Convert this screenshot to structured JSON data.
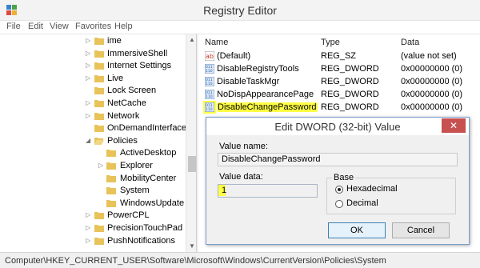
{
  "window": {
    "title": "Registry Editor",
    "icon": "registry-editor-icon"
  },
  "menu": [
    "File",
    "Edit",
    "View",
    "Favorites",
    "Help"
  ],
  "tree": {
    "items": [
      {
        "label": "ime",
        "expandable": true
      },
      {
        "label": "ImmersiveShell",
        "expandable": true
      },
      {
        "label": "Internet Settings",
        "expandable": true
      },
      {
        "label": "Live",
        "expandable": true
      },
      {
        "label": "Lock Screen",
        "expandable": false
      },
      {
        "label": "NetCache",
        "expandable": true
      },
      {
        "label": "Network",
        "expandable": true
      },
      {
        "label": "OnDemandInterfaceCa",
        "expandable": false
      },
      {
        "label": "Policies",
        "expandable": true,
        "expanded": true
      },
      {
        "label": "ActiveDesktop",
        "expandable": false
      },
      {
        "label": "Explorer",
        "expandable": true
      },
      {
        "label": "MobilityCenter",
        "expandable": false
      },
      {
        "label": "System",
        "expandable": false
      },
      {
        "label": "WindowsUpdate",
        "expandable": false
      },
      {
        "label": "PowerCPL",
        "expandable": true
      },
      {
        "label": "PrecisionTouchPad",
        "expandable": true
      },
      {
        "label": "PushNotifications",
        "expandable": true
      }
    ]
  },
  "values": {
    "headers": {
      "name": "Name",
      "type": "Type",
      "data": "Data"
    },
    "rows": [
      {
        "name": "(Default)",
        "type": "REG_SZ",
        "data": "(value not set)",
        "icon": "string-value-icon"
      },
      {
        "name": "DisableRegistryTools",
        "type": "REG_DWORD",
        "data": "0x00000000 (0)",
        "icon": "dword-value-icon"
      },
      {
        "name": "DisableTaskMgr",
        "type": "REG_DWORD",
        "data": "0x00000000 (0)",
        "icon": "dword-value-icon"
      },
      {
        "name": "NoDispAppearancePage",
        "type": "REG_DWORD",
        "data": "0x00000000 (0)",
        "icon": "dword-value-icon"
      },
      {
        "name": "DisableChangePassword",
        "type": "REG_DWORD",
        "data": "0x00000000 (0)",
        "icon": "dword-value-icon",
        "highlighted": true
      }
    ]
  },
  "dialog": {
    "title": "Edit DWORD (32-bit) Value",
    "value_name_label": "Value name:",
    "value_name": "DisableChangePassword",
    "value_data_label": "Value data:",
    "value_data": "1",
    "base_label": "Base",
    "hex_label": "Hexadecimal",
    "dec_label": "Decimal",
    "selected_base": "Hexadecimal",
    "ok_label": "OK",
    "cancel_label": "Cancel",
    "close_glyph": "✕"
  },
  "status": {
    "path": "Computer\\HKEY_CURRENT_USER\\Software\\Microsoft\\Windows\\CurrentVersion\\Policies\\System"
  },
  "colors": {
    "highlight": "#ffff44",
    "folder": "#e8c35a",
    "close": "#c75050"
  }
}
